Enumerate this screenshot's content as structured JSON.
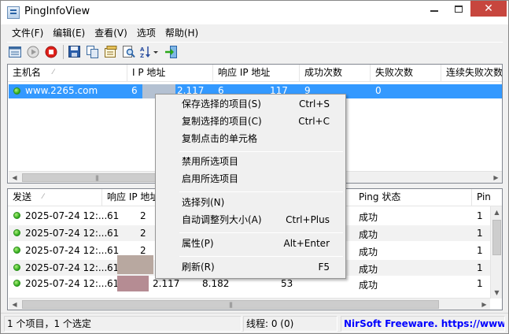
{
  "window": {
    "title": "PingInfoView",
    "close_glyph": "✕"
  },
  "menubar": [
    "文件(F)",
    "编辑(E)",
    "查看(V)",
    "选项",
    "帮助(H)"
  ],
  "toolbar": {
    "icons": [
      "options-icon",
      "start-icon",
      "stop-icon",
      "save-icon",
      "copy-icon",
      "properties-icon",
      "find-icon",
      "sort-icon",
      "exit-icon"
    ]
  },
  "upper_list": {
    "columns": [
      "主机名",
      "I P 地址",
      "响应 IP 地址",
      "成功次数",
      "失败次数",
      "连续失败次数"
    ],
    "row": {
      "host": "www.2265.com",
      "ip_prefix": "6",
      "ip_suffix": "2.117",
      "resp_prefix": "6",
      "resp_suffix": "117",
      "success": "9",
      "fail": "0"
    }
  },
  "lower_list": {
    "columns": [
      "发送",
      "响应 IP 地址",
      "Ping 状态",
      "Pin"
    ],
    "rows": [
      {
        "time": "2025-07-24 12:...",
        "ip": "61",
        "ip_tail": "2",
        "status": "成功",
        "ping": "1"
      },
      {
        "time": "2025-07-24 12:...",
        "ip": "61",
        "ip_tail": "2",
        "status": "成功",
        "ping": "1"
      },
      {
        "time": "2025-07-24 12:...",
        "ip": "61",
        "ip_tail": "2",
        "status": "成功",
        "ping": "1"
      },
      {
        "time": "2025-07-24 12:...",
        "ip": "61",
        "ip_tail": "",
        "status": "成功",
        "ping": "1"
      },
      {
        "time": "2025-07-24 12:...",
        "ip": "61",
        "ip_tail": "2.117",
        "ms": "8.182",
        "ttl": "53",
        "status": "成功",
        "ping": "1"
      }
    ]
  },
  "context_menu": [
    {
      "label": "保存选择的项目(S)",
      "key": "Ctrl+S"
    },
    {
      "label": "复制选择的项目(C)",
      "key": "Ctrl+C"
    },
    {
      "label": "复制点击的单元格",
      "key": ""
    },
    {
      "label": "禁用所选项目",
      "key": ""
    },
    {
      "label": "启用所选项目",
      "key": ""
    },
    {
      "label": "选择列(N)",
      "key": ""
    },
    {
      "label": "自动调整列大小(A)",
      "key": "Ctrl+Plus"
    },
    {
      "label": "属性(P)",
      "key": "Alt+Enter"
    },
    {
      "label": "刷新(R)",
      "key": "F5"
    }
  ],
  "statusbar": {
    "items": "1 个项目，1 个选定",
    "threads": "线程: 0 (0)",
    "link": "NirSoft Freeware. https://www.nirsoft.net"
  },
  "colors": {
    "selection": "#3399ff",
    "close_button": "#c7463e",
    "link": "#0000ff"
  }
}
